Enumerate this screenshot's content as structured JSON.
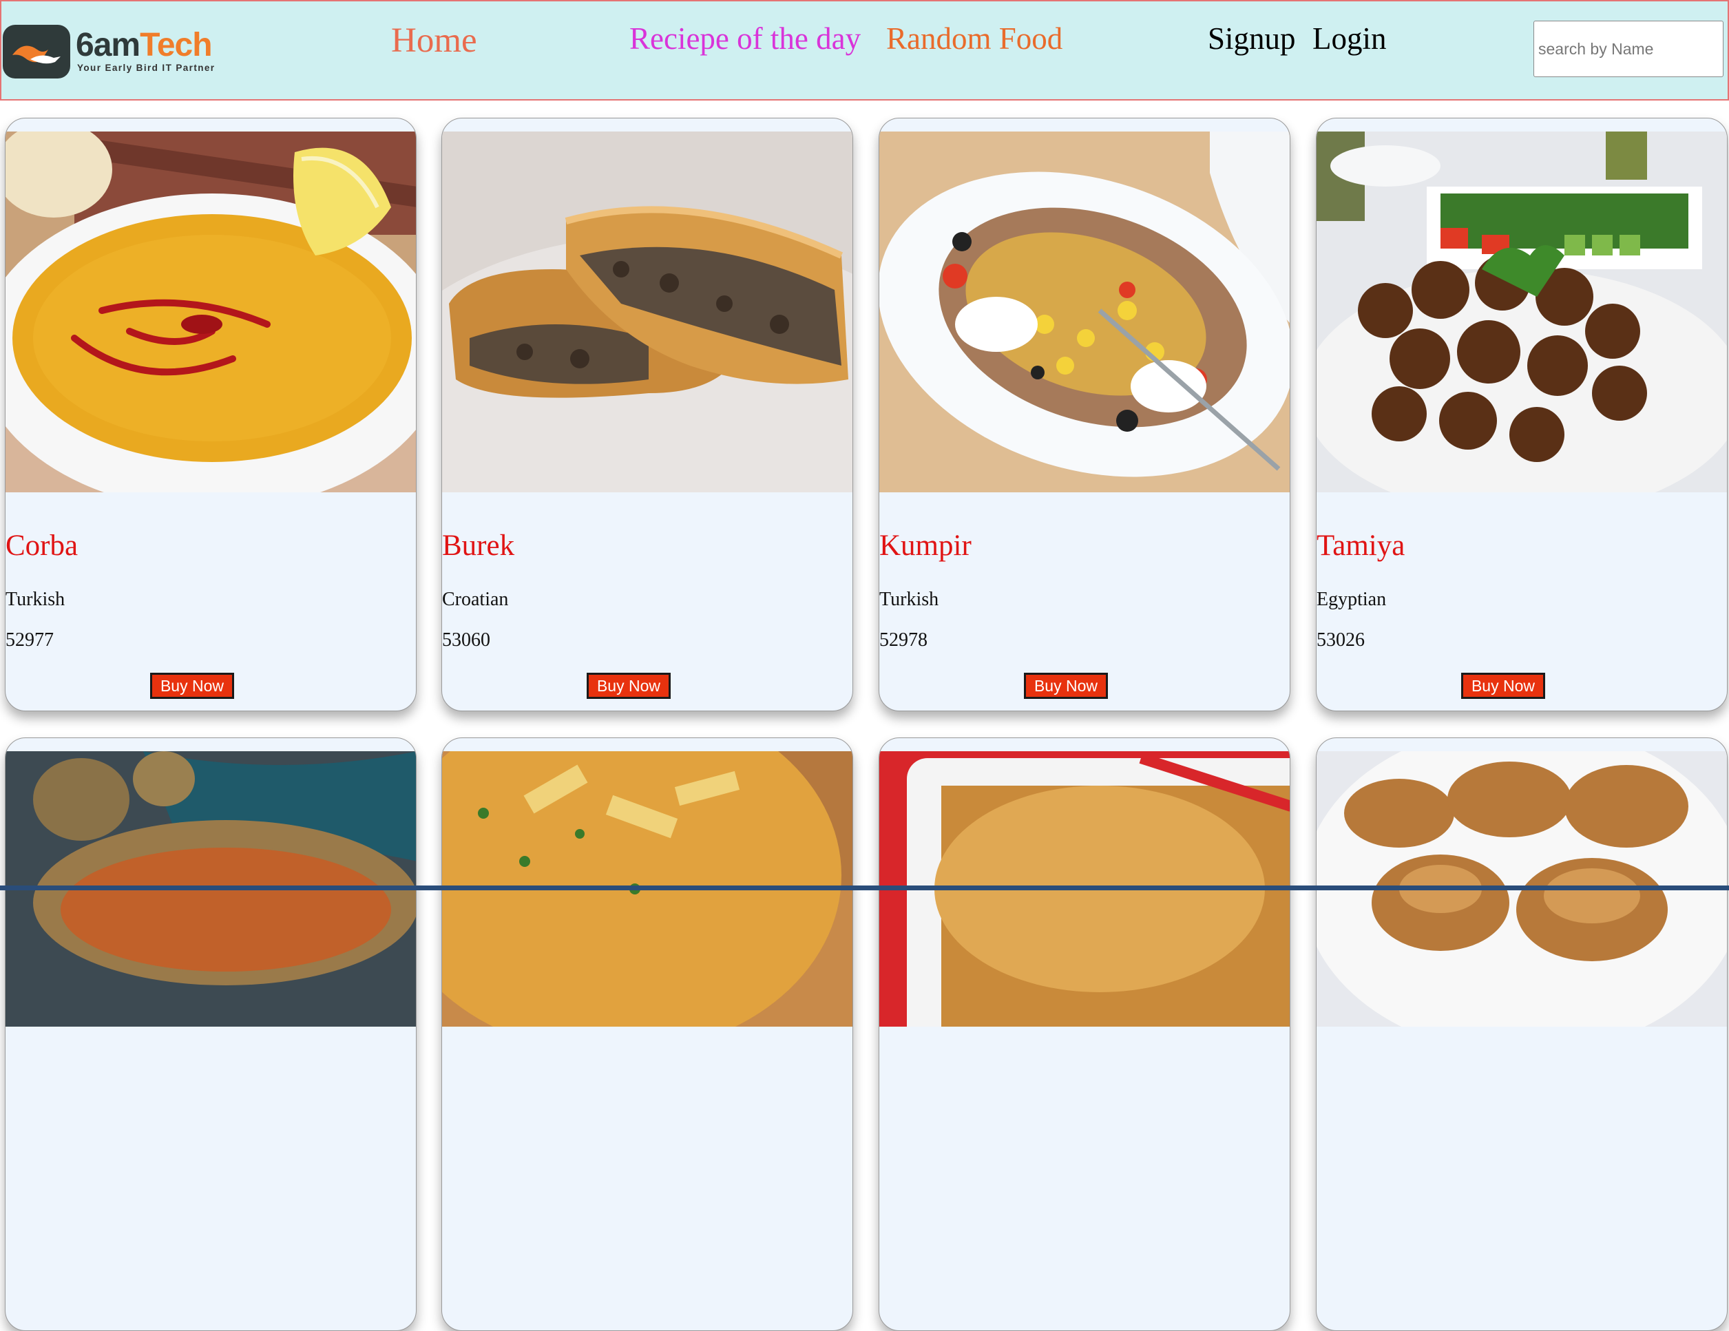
{
  "header": {
    "logo": {
      "word_dark": "6am",
      "word_orange": "Tech",
      "tagline": "Your Early Bird IT Partner"
    },
    "nav": {
      "home": "Home",
      "recipe_of_day": "Reciepe of the day",
      "random_food": "Random Food",
      "signup": "Signup",
      "login": "Login"
    },
    "search": {
      "placeholder": "search by Name",
      "value": ""
    }
  },
  "cards": [
    {
      "name": "Corba",
      "area": "Turkish",
      "id": "52977",
      "button": "Buy Now"
    },
    {
      "name": "Burek",
      "area": "Croatian",
      "id": "53060",
      "button": "Buy Now"
    },
    {
      "name": "Kumpir",
      "area": "Turkish",
      "id": "52978",
      "button": "Buy Now"
    },
    {
      "name": "Tamiya",
      "area": "Egyptian",
      "id": "53026",
      "button": "Buy Now"
    }
  ],
  "colors": {
    "header_bg": "#cff0f1",
    "card_bg": "#eef5fd",
    "title_red": "#e01414",
    "button_red": "#e8320e",
    "home_link": "#e96b4e",
    "recipe_link": "#d934d9",
    "random_link": "#e96b2b"
  }
}
